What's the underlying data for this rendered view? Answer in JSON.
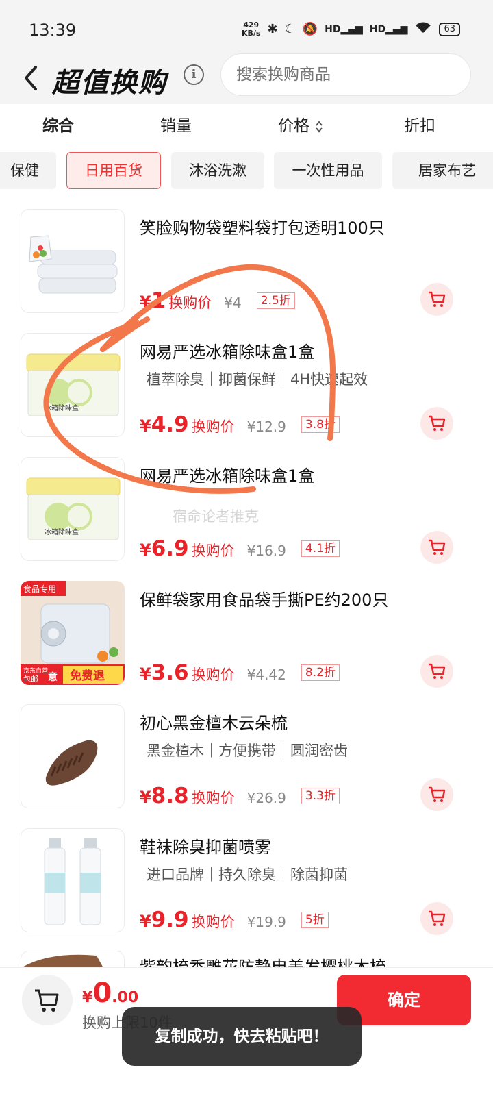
{
  "status_bar": {
    "time": "13:39",
    "net_speed_value": "429",
    "net_speed_unit": "KB/s",
    "signal_1": "HD",
    "signal_2": "HD",
    "battery": "63"
  },
  "header": {
    "title": "超值换购",
    "search_placeholder": "搜索换购商品"
  },
  "sort_tabs": [
    {
      "label": "综合"
    },
    {
      "label": "销量"
    },
    {
      "label": "价格"
    },
    {
      "label": "折扣"
    }
  ],
  "categories": [
    {
      "label": "保健"
    },
    {
      "label": "日用百货"
    },
    {
      "label": "沐浴洗漱"
    },
    {
      "label": "一次性用品"
    },
    {
      "label": "居家布艺"
    }
  ],
  "products": [
    {
      "name": "笑脸购物袋塑料袋打包透明100只",
      "tags": "",
      "yen": "¥",
      "price": "1",
      "price_label": "换购价",
      "original": "¥4",
      "discount": "2.5折"
    },
    {
      "name": "网易严选冰箱除味盒1盒",
      "tags": "植萃除臭｜抑菌保鲜｜4H快速起效",
      "yen": "¥",
      "price": "4.9",
      "price_label": "换购价",
      "original": "¥12.9",
      "discount": "3.8折"
    },
    {
      "name": "网易严选冰箱除味盒1盒",
      "tags": "",
      "yen": "¥",
      "price": "6.9",
      "price_label": "换购价",
      "original": "¥16.9",
      "discount": "4.1折"
    },
    {
      "name": "保鲜袋家用食品袋手撕PE约200只",
      "tags": "",
      "yen": "¥",
      "price": "3.6",
      "price_label": "换购价",
      "original": "¥4.42",
      "discount": "8.2折"
    },
    {
      "name": "初心黑金檀木云朵梳",
      "tags": "黑金檀木｜方便携带｜圆润密齿",
      "yen": "¥",
      "price": "8.8",
      "price_label": "换购价",
      "original": "¥26.9",
      "discount": "3.3折"
    },
    {
      "name": "鞋袜除臭抑菌喷雾",
      "tags": "进口品牌｜持久除臭｜除菌抑菌",
      "yen": "¥",
      "price": "9.9",
      "price_label": "换购价",
      "original": "¥19.9",
      "discount": "5折"
    }
  ],
  "partial_product_name": "紫韵梳香雕花防静电美发樱桃木梳",
  "thumb_texts": {
    "box_label": "冰箱除味盒",
    "food_badge": "食品专用",
    "jd_badge": "京东自营",
    "free_ship": "包邮",
    "free_return": "免费退",
    "yi": "意"
  },
  "watermark": "宿命论者推克",
  "bottom_bar": {
    "yen": "¥",
    "total_int": "0",
    "total_dec": ".00",
    "limit": "换购上限10件",
    "confirm": "确定"
  },
  "toast": "复制成功，快去粘贴吧！",
  "colors": {
    "accent": "#e8242a",
    "scribble": "#f2784b",
    "confirm_bg": "#f22a31"
  }
}
